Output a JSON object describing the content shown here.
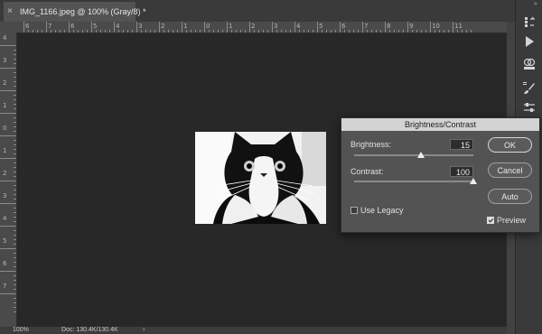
{
  "document_tab": {
    "close_glyph": "×",
    "title": "IMG_1166.jpeg @ 100% (Gray/8) *"
  },
  "ruler": {
    "top_labels": [
      "6",
      "7",
      "6",
      "5",
      "4",
      "3",
      "2",
      "1",
      "0",
      "1",
      "2",
      "3",
      "4",
      "5",
      "6",
      "7",
      "8",
      "9",
      "10",
      "11"
    ],
    "left_labels": [
      "4",
      "3",
      "2",
      "1",
      "0",
      "1",
      "2",
      "3",
      "4",
      "5",
      "6",
      "7"
    ]
  },
  "status_bar": {
    "zoom": "100%",
    "doc_size": "Doc: 130.4K/130.4K",
    "arrow": "›"
  },
  "dialog": {
    "title": "Brightness/Contrast",
    "brightness_label": "Brightness:",
    "brightness_value": "15",
    "brightness_fraction": 0.56,
    "contrast_label": "Contrast:",
    "contrast_value": "100",
    "contrast_fraction": 1.0,
    "use_legacy_label": "Use Legacy",
    "use_legacy_checked": false,
    "preview_label": "Preview",
    "preview_checked": true,
    "ok_label": "OK",
    "cancel_label": "Cancel",
    "auto_label": "Auto"
  },
  "right_toolbar": {
    "top_glyph": "»",
    "icons": [
      "history-icon",
      "play-action-icon",
      "channels-icon",
      "brush-icon",
      "adjustments-icon"
    ]
  },
  "colors": {
    "canvas": "#282828",
    "workspace": "#535353",
    "dialog_title_bg": "#d2d2d2"
  }
}
